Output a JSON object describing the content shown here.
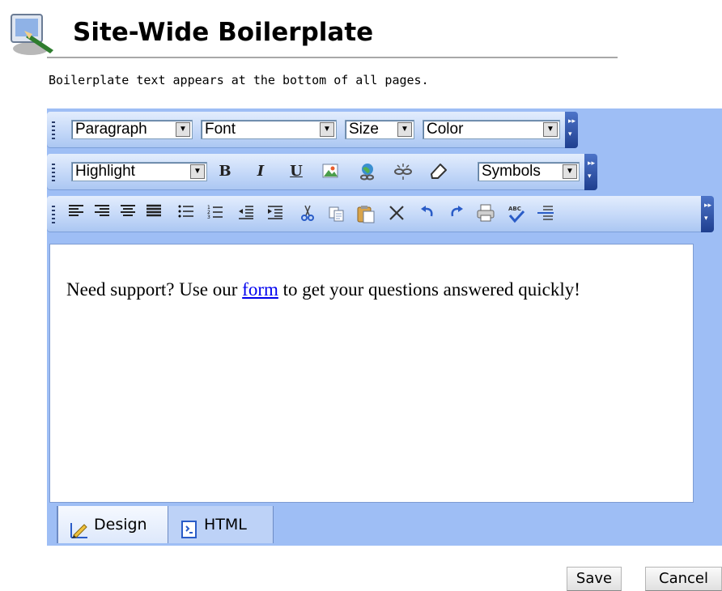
{
  "header": {
    "title": "Site-Wide Boilerplate",
    "description": "Boilerplate text appears at the bottom of all pages."
  },
  "toolbar1": {
    "paragraph": "Paragraph",
    "font": "Font",
    "size": "Size",
    "color": "Color"
  },
  "toolbar2": {
    "highlight": "Highlight",
    "bold": "B",
    "italic": "I",
    "underline": "U",
    "symbols": "Symbols"
  },
  "toolbar3": {
    "icons": [
      "align-left-icon",
      "align-right-icon",
      "align-center-icon",
      "justify-icon",
      "bulleted-list-icon",
      "numbered-list-icon",
      "outdent-icon",
      "indent-icon",
      "cut-icon",
      "copy-icon",
      "paste-icon",
      "delete-icon",
      "undo-icon",
      "redo-icon",
      "print-icon",
      "spellcheck-icon",
      "horizontal-rule-icon"
    ]
  },
  "content": {
    "text_before": "Need support? Use our ",
    "link": "form",
    "text_after": " to get your questions answered quickly!"
  },
  "tabs": {
    "design": "Design",
    "html": "HTML"
  },
  "actions": {
    "save": "Save",
    "cancel": "Cancel"
  },
  "colors": {
    "editor_bg": "#9ebef5",
    "link": "#0000ee"
  }
}
